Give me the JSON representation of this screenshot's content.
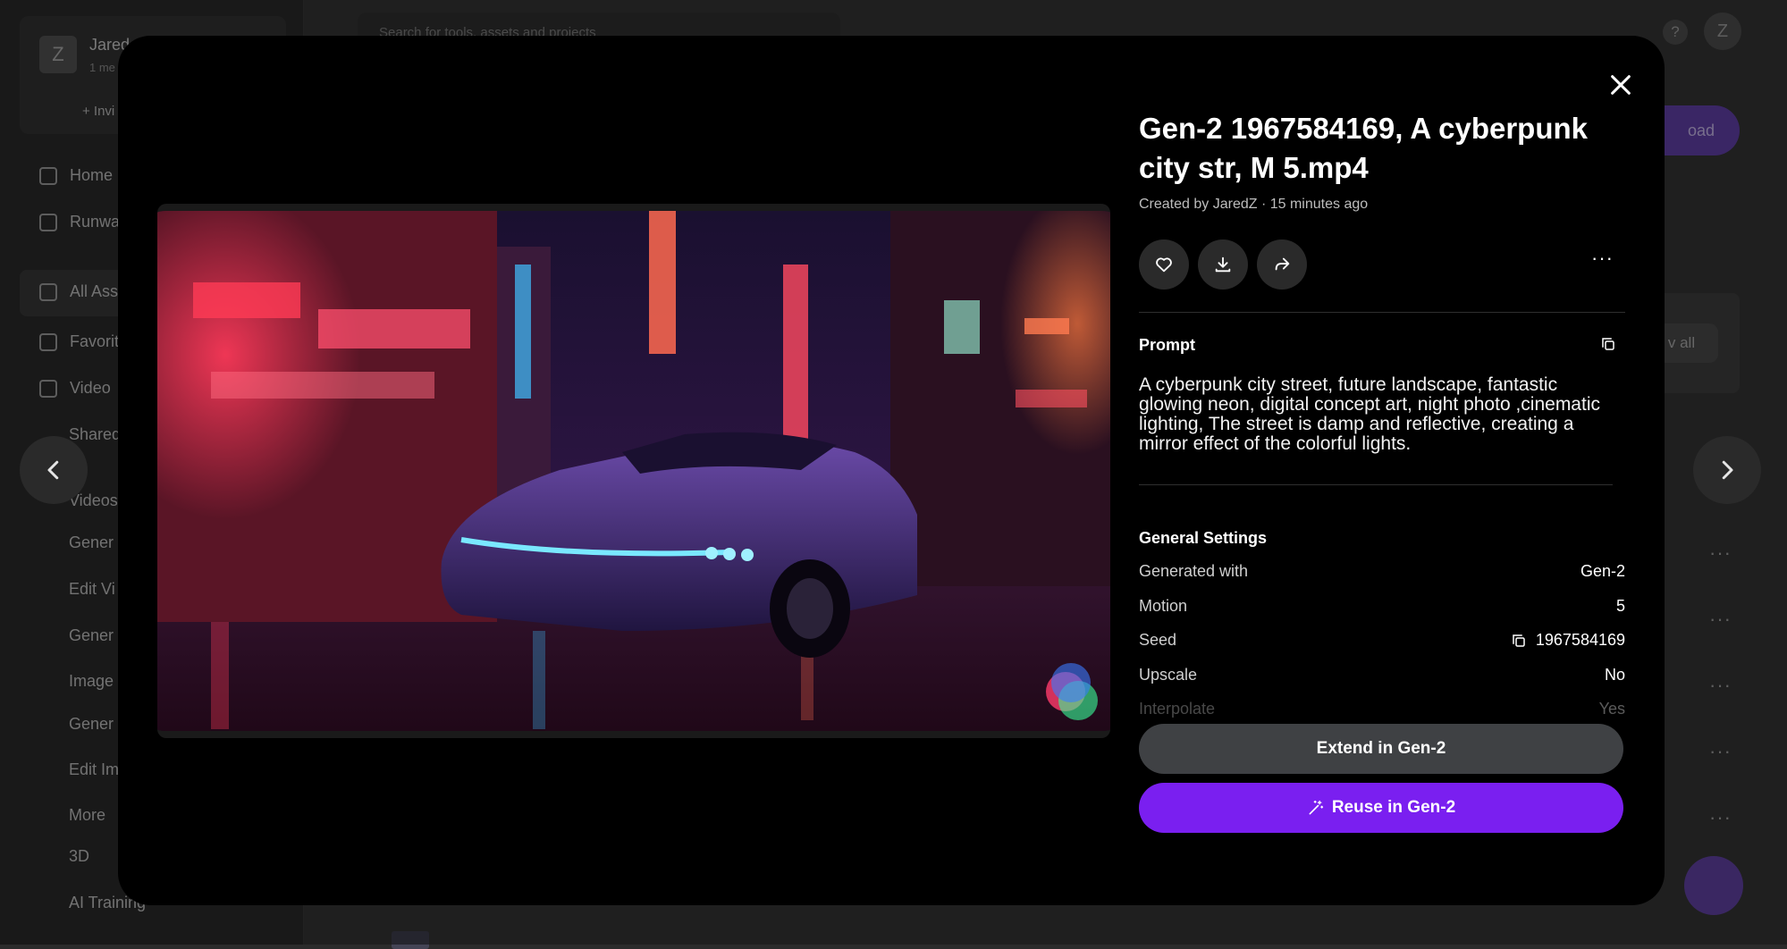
{
  "background": {
    "workspace": {
      "avatar_letter": "Z",
      "name": "Jared",
      "subtitle": "1 me",
      "invite": "+ Invi"
    },
    "nav": [
      "Home",
      "Runwa",
      "All Ass",
      "Favorit",
      "Video",
      "Shared"
    ],
    "sections": {
      "videos": "Videos",
      "videos_items": [
        "Gener",
        "Edit Vi",
        "Gener"
      ],
      "images": "Image",
      "images_items": [
        "Gener",
        "Edit Im"
      ],
      "more": "More",
      "more_items": [
        "3D",
        "AI Training"
      ]
    },
    "search_placeholder": "Search for tools, assets and projects",
    "help": "?",
    "user_avatar": "Z",
    "upload_label": "oad",
    "view_all": "v all",
    "row_dots": "···"
  },
  "modal": {
    "title": "Gen-2 1967584169, A cyberpunk city str, M 5.mp4",
    "meta": "Created by JaredZ · 15 minutes ago",
    "prompt_heading": "Prompt",
    "prompt_text": "A cyberpunk city street, future landscape, fantastic glowing neon, digital concept art, night photo ,cinematic lighting, The street is damp and reflective, creating a mirror effect of the colorful lights.",
    "settings_heading": "General Settings",
    "settings": [
      {
        "label": "Generated with",
        "value": "Gen-2"
      },
      {
        "label": "Motion",
        "value": "5"
      },
      {
        "label": "Seed",
        "value": "1967584169"
      },
      {
        "label": "Upscale",
        "value": "No"
      },
      {
        "label": "Interpolate",
        "value": "Yes"
      }
    ],
    "extend_label": "Extend in Gen-2",
    "reuse_label": "Reuse in Gen-2",
    "more_label": "···"
  },
  "icons": {
    "close": "close-icon",
    "prev": "chevron-left-icon",
    "next": "chevron-right-icon",
    "favorite": "heart-icon",
    "download": "download-icon",
    "share": "share-icon",
    "copy": "copy-icon",
    "wand": "magic-wand-icon"
  },
  "colors": {
    "accent": "#7a1ff0",
    "secondary_button": "#3f4144",
    "modal_bg": "#000000"
  }
}
